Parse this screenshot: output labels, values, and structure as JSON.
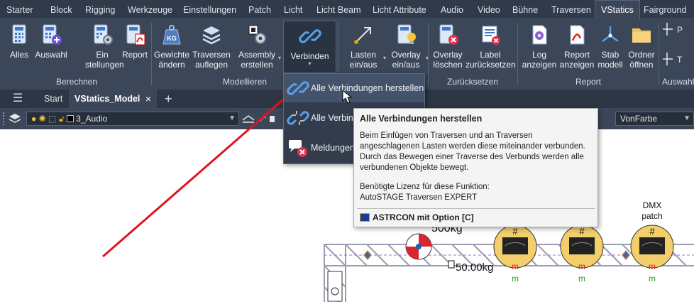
{
  "ribbon_tabs": [
    "Starter",
    "Block",
    "Rigging",
    "Werkzeuge",
    "Einstellungen",
    "Patch",
    "Licht",
    "Licht Beam",
    "Licht Attribute",
    "Audio",
    "Video",
    "Bühne",
    "Traversen",
    "VStatics",
    "Fairground"
  ],
  "active_tab": "VStatics",
  "panels": {
    "berechnen": {
      "title": "Berechnen",
      "buttons": [
        {
          "label1": "Alles",
          "label2": ""
        },
        {
          "label1": "Auswahl",
          "label2": ""
        },
        {
          "label1": "Ein",
          "label2": "stellungen"
        },
        {
          "label1": "Report",
          "label2": ""
        }
      ]
    },
    "modellieren": {
      "title": "Modellieren",
      "buttons": [
        {
          "label1": "Gewichte",
          "label2": "ändern"
        },
        {
          "label1": "Traversen",
          "label2": "auflegen"
        },
        {
          "label1": "Assembly",
          "label2": "erstellen"
        },
        {
          "label1": "Verbinden",
          "label2": ""
        }
      ]
    },
    "lasten": {
      "buttons": [
        {
          "label1": "Lasten",
          "label2": "ein/aus"
        },
        {
          "label1": "Overlay",
          "label2": "ein/aus"
        }
      ]
    },
    "zuruecksetzen": {
      "title": "Zurücksetzen",
      "buttons": [
        {
          "label1": "Overlay",
          "label2": "löschen"
        },
        {
          "label1": "Label",
          "label2": "zurücksetzen"
        }
      ]
    },
    "report": {
      "title": "Report",
      "buttons": [
        {
          "label1": "Log",
          "label2": "anzeigen"
        },
        {
          "label1": "Report",
          "label2": "anzeigen"
        },
        {
          "label1": "Stab",
          "label2": "modell"
        },
        {
          "label1": "Ordner",
          "label2": "öffnen"
        }
      ]
    },
    "auswahl": {
      "title": "Auswahl",
      "labels": [
        "P",
        "T"
      ]
    }
  },
  "file_tabs": {
    "start": "Start",
    "active": "VStatics_Model",
    "close": "×",
    "add": "+"
  },
  "layer": {
    "current": "3_Audio",
    "color_value": "VonFarbe"
  },
  "menu": {
    "items": [
      "Alle Verbindungen herstellen",
      "Alle Verbindungen",
      "Meldungen"
    ]
  },
  "tooltip": {
    "title": "Alle Verbindungen herstellen",
    "body": "Beim Einfügen von Traversen und an Traversen\nangeschlagenen Lasten werden diese miteinander verbunden.\nDurch das Bewegen einer Traverse des Verbunds werden alle\nverbundenen Objekte bewegt.",
    "license": "Benötigte Lizenz für diese Funktion:\nAutoSTAGE Traversen EXPERT",
    "footer": "ASTRCON mit Option [C]"
  },
  "canvas": {
    "load_top": "500kg",
    "load_label": "50.00kg",
    "dmx_label_1": "DMX",
    "dmx_label_2": "patch",
    "fixture_hash": "#",
    "fixture_m": "m"
  },
  "colors": {
    "ribbon_bg": "#3b4658",
    "arrow": "#e0141e",
    "truss": "#a9a9b8",
    "fixture": "#f2cf6a"
  }
}
